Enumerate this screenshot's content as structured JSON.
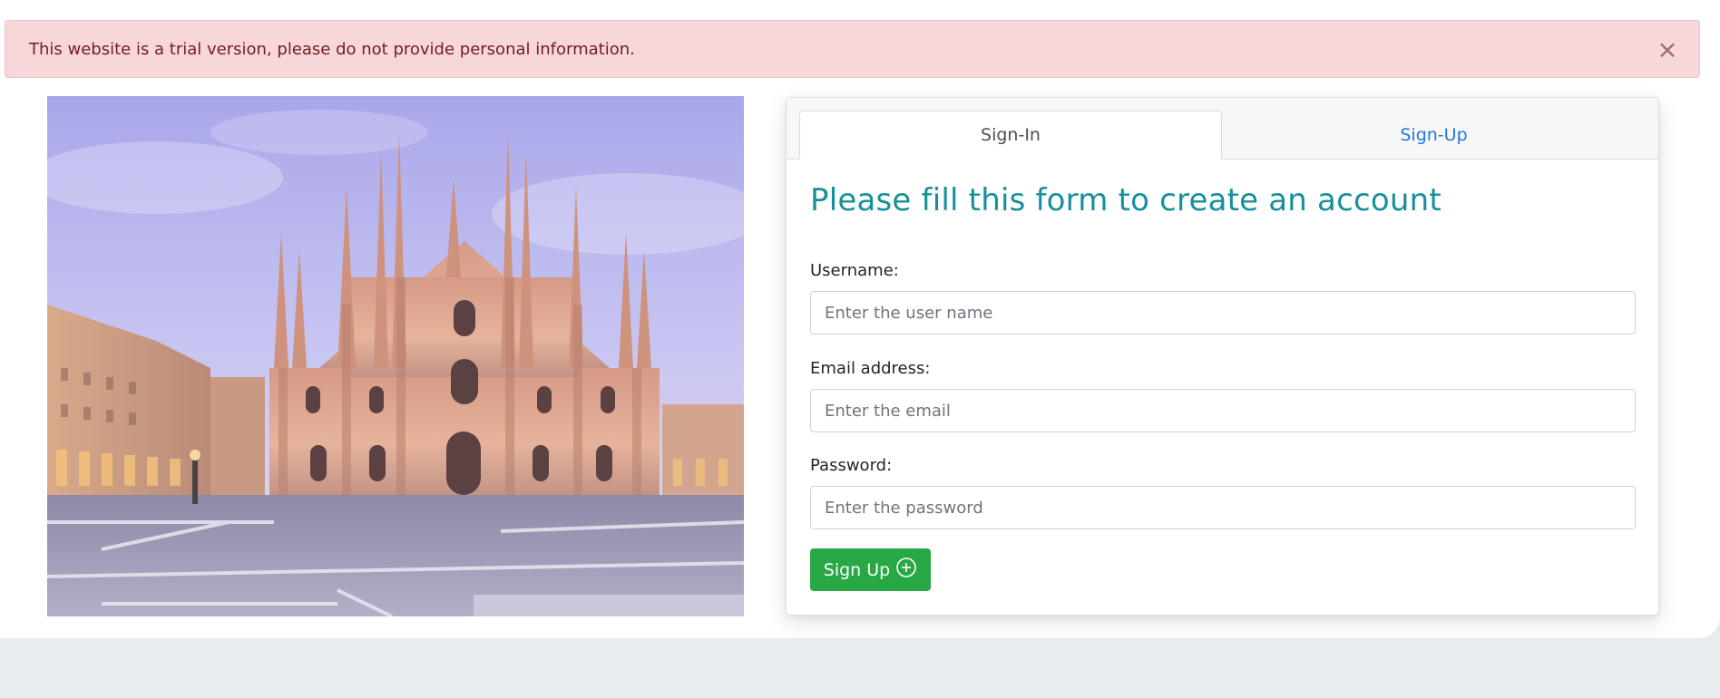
{
  "alert": {
    "message": "This website is a trial version, please do not provide personal information.",
    "close_symbol": "×"
  },
  "hero": {
    "icon": "cathedral-photo"
  },
  "tabs": [
    {
      "label": "Sign-In",
      "active": true
    },
    {
      "label": "Sign-Up",
      "active": false
    }
  ],
  "form": {
    "title": "Please fill this form to create an account",
    "username": {
      "label": "Username:",
      "placeholder": "Enter the user name",
      "value": ""
    },
    "email": {
      "label": "Email address:",
      "placeholder": "Enter the email",
      "value": ""
    },
    "password": {
      "label": "Password:",
      "placeholder": "Enter the password",
      "value": ""
    },
    "submit_label": "Sign Up",
    "submit_icon": "plus-circle-icon"
  },
  "colors": {
    "alert_bg": "#f8d7da",
    "alert_text": "#721c24",
    "title": "#17909a",
    "link": "#1f7ae0",
    "button": "#28a745"
  }
}
